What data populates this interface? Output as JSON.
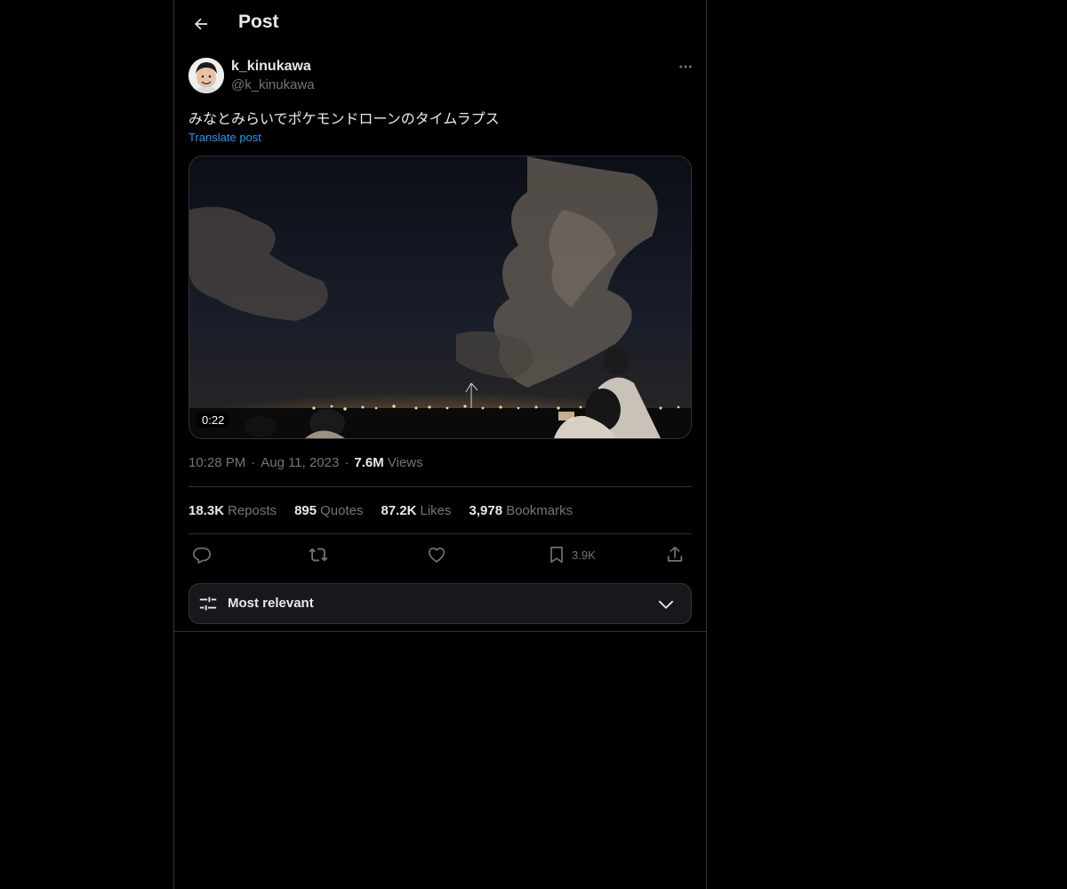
{
  "header": {
    "title": "Post",
    "back_icon": "arrow-left-icon"
  },
  "author": {
    "display_name": "k_kinukawa",
    "handle": "@k_kinukawa",
    "more_icon": "more-horizontal-icon"
  },
  "post": {
    "text": "みなとみらいでポケモンドローンのタイムラプス",
    "translate_label": "Translate post",
    "video_duration": "0:22"
  },
  "meta": {
    "time": "10:28 PM",
    "date": "Aug 11, 2023",
    "views_count": "7.6M",
    "views_label": "Views"
  },
  "stats": [
    {
      "count": "18.3K",
      "label": "Reposts"
    },
    {
      "count": "895",
      "label": "Quotes"
    },
    {
      "count": "87.2K",
      "label": "Likes"
    },
    {
      "count": "3,978",
      "label": "Bookmarks"
    }
  ],
  "actions": {
    "reply_icon": "reply-icon",
    "repost_icon": "repost-icon",
    "like_icon": "heart-icon",
    "bookmark_icon": "bookmark-icon",
    "bookmark_count": "3.9K",
    "share_icon": "share-icon"
  },
  "sort": {
    "label": "Most relevant",
    "icon": "sliders-icon",
    "chevron": "chevron-down-icon"
  },
  "colors": {
    "background": "#000000",
    "text": "#e7e9ea",
    "muted": "#71767b",
    "accent": "#1d9bf0",
    "border": "#2f3336"
  }
}
